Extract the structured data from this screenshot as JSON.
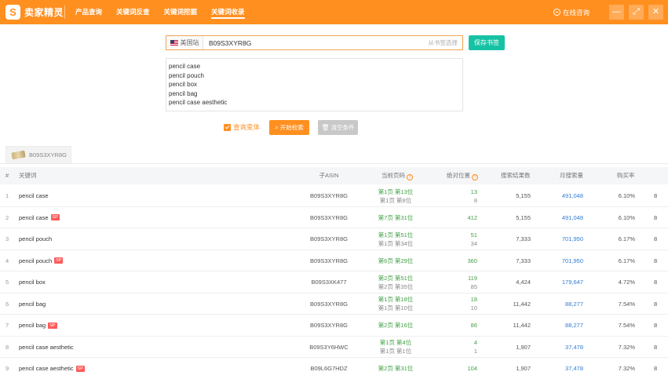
{
  "app": {
    "logo_mark": "S",
    "logo_text": "卖家精灵",
    "nav": [
      {
        "label": "产品查询",
        "active": false
      },
      {
        "label": "关键词反查",
        "active": false
      },
      {
        "label": "关键词挖掘",
        "active": false
      },
      {
        "label": "关键词收录",
        "active": true
      }
    ],
    "consult_label": "在线咨询",
    "window": {
      "minimize": "—",
      "maximize": "⤢",
      "close": "✕"
    }
  },
  "search": {
    "site_label": "美国站",
    "asin_value": "B09S3XYR8G",
    "hint": "从书签选择",
    "save_label": "保存书签",
    "keywords": [
      "pencil case",
      "pencil pouch",
      "pencil box",
      "pencil bag",
      "pencil case aesthetic"
    ],
    "variant_label": "查询变体",
    "start_label": "开始检索",
    "clear_label": "清空条件"
  },
  "product_tab": {
    "asin": "B09S3XYR8G"
  },
  "table": {
    "headers": {
      "idx": "#",
      "keyword": "关键词",
      "asin": "子ASIN",
      "rank": "当前页码",
      "position": "绝对位置",
      "total": "搜索结果数",
      "volume": "月搜索量",
      "rate": "购买率"
    },
    "sp_label": "SP",
    "rows": [
      {
        "idx": "1",
        "keyword": "pencil case",
        "sp": false,
        "asin": "B09S3XYR8G",
        "rank": "第1页 第13位",
        "rank2": "第1页 第8位",
        "pos": "13",
        "pos2": "8",
        "total": "5,155",
        "volume": "491,048",
        "rate": "6.10%",
        "more": "8"
      },
      {
        "idx": "2",
        "keyword": "pencil case",
        "sp": true,
        "asin": "B09S3XYR8G",
        "rank": "第7页 第31位",
        "rank2": "",
        "pos": "412",
        "pos2": "",
        "total": "5,155",
        "volume": "491,048",
        "rate": "6.10%",
        "more": "8"
      },
      {
        "idx": "3",
        "keyword": "pencil pouch",
        "sp": false,
        "asin": "B09S3XYR8G",
        "rank": "第1页 第51位",
        "rank2": "第1页 第34位",
        "pos": "51",
        "pos2": "34",
        "total": "7,333",
        "volume": "701,950",
        "rate": "6.17%",
        "more": "8"
      },
      {
        "idx": "4",
        "keyword": "pencil pouch",
        "sp": true,
        "asin": "B09S3XYR8G",
        "rank": "第6页 第29位",
        "rank2": "",
        "pos": "360",
        "pos2": "",
        "total": "7,333",
        "volume": "701,950",
        "rate": "6.17%",
        "more": "8"
      },
      {
        "idx": "5",
        "keyword": "pencil box",
        "sp": false,
        "asin": "B09S3XK477",
        "rank": "第2页 第51位",
        "rank2": "第2页 第35位",
        "pos": "119",
        "pos2": "85",
        "total": "4,424",
        "volume": "179,647",
        "rate": "4.72%",
        "more": "8"
      },
      {
        "idx": "6",
        "keyword": "pencil bag",
        "sp": false,
        "asin": "B09S3XYR8G",
        "rank": "第1页 第18位",
        "rank2": "第1页 第10位",
        "pos": "18",
        "pos2": "10",
        "total": "11,442",
        "volume": "88,277",
        "rate": "7.54%",
        "more": "8"
      },
      {
        "idx": "7",
        "keyword": "pencil bag",
        "sp": true,
        "asin": "B09S3XYR8G",
        "rank": "第2页 第16位",
        "rank2": "",
        "pos": "86",
        "pos2": "",
        "total": "11,442",
        "volume": "88,277",
        "rate": "7.54%",
        "more": "8"
      },
      {
        "idx": "8",
        "keyword": "pencil case aesthetic",
        "sp": false,
        "asin": "B09S3Y6HWC",
        "rank": "第1页 第4位",
        "rank2": "第1页 第1位",
        "pos": "4",
        "pos2": "1",
        "total": "1,907",
        "volume": "37,478",
        "rate": "7.32%",
        "more": "8"
      },
      {
        "idx": "9",
        "keyword": "pencil case aesthetic",
        "sp": true,
        "asin": "B09L6G7HDZ",
        "rank": "第2页 第31位",
        "rank2": "",
        "pos": "104",
        "pos2": "",
        "total": "1,907",
        "volume": "37,478",
        "rate": "7.32%",
        "more": "8"
      }
    ]
  },
  "colors": {
    "brand": "#ff8f1f",
    "save": "#17c2a4",
    "rank": "#43a047",
    "volume": "#2f7cd3",
    "sp": "#ff5a5a"
  }
}
